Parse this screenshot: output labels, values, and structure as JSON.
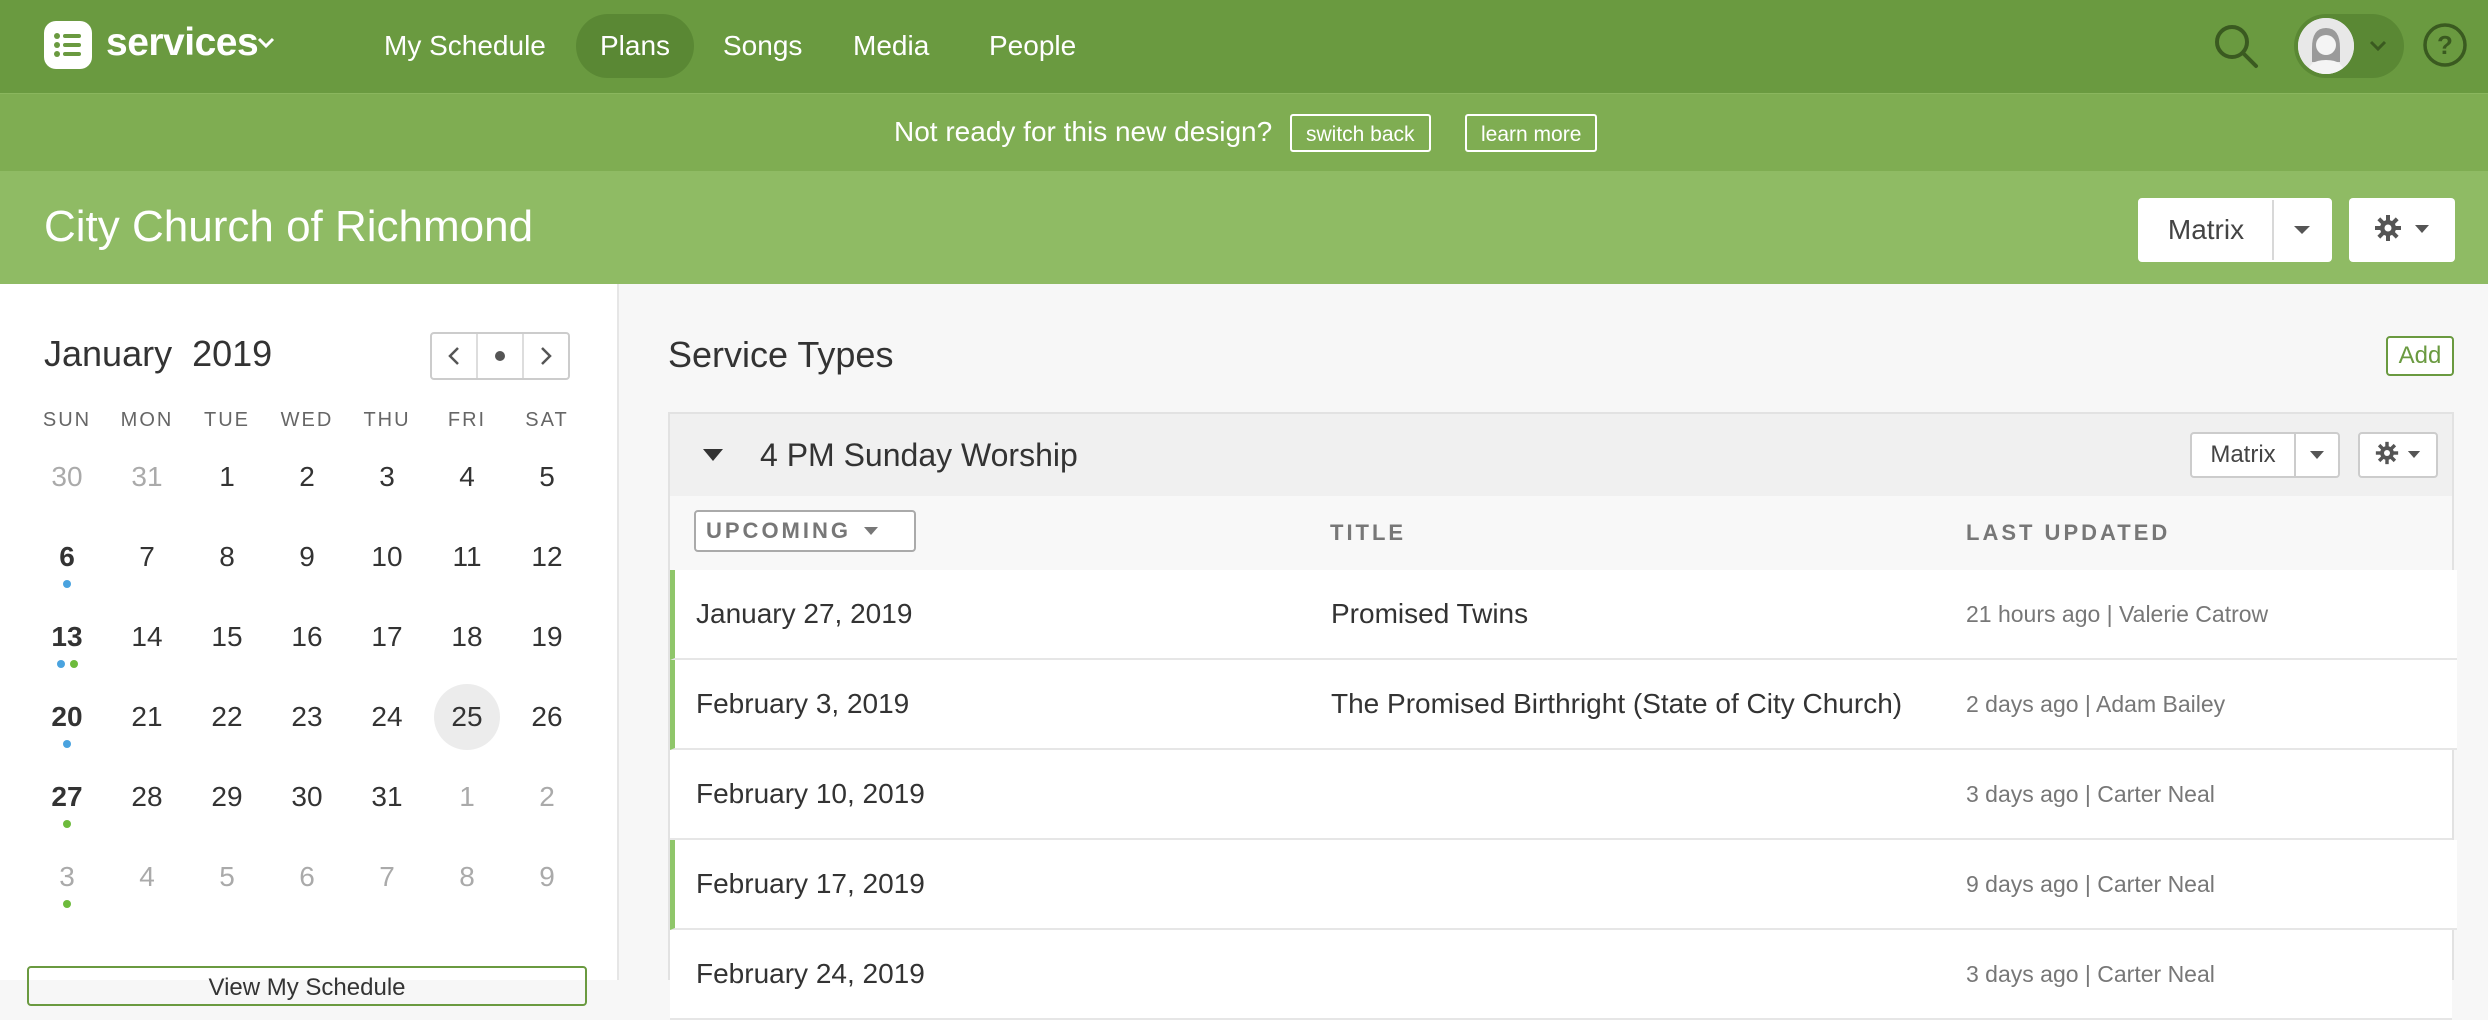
{
  "app": {
    "name": "services"
  },
  "nav": {
    "items": [
      {
        "label": "My Schedule",
        "active": false
      },
      {
        "label": "Plans",
        "active": true
      },
      {
        "label": "Songs",
        "active": false
      },
      {
        "label": "Media",
        "active": false
      },
      {
        "label": "People",
        "active": false
      }
    ]
  },
  "banner": {
    "text": "Not ready for this new design?",
    "switch_back": "switch back",
    "learn_more": "learn more"
  },
  "org": {
    "title": "City Church of Richmond",
    "view_label": "Matrix"
  },
  "calendar": {
    "month": "January",
    "year": "2019",
    "weekdays": [
      "SUN",
      "MON",
      "TUE",
      "WED",
      "THU",
      "FRI",
      "SAT"
    ],
    "weeks": [
      [
        {
          "d": "30",
          "other": true
        },
        {
          "d": "31",
          "other": true
        },
        {
          "d": "1"
        },
        {
          "d": "2"
        },
        {
          "d": "3"
        },
        {
          "d": "4"
        },
        {
          "d": "5"
        }
      ],
      [
        {
          "d": "6",
          "bold": true,
          "dots": [
            "blue"
          ]
        },
        {
          "d": "7"
        },
        {
          "d": "8"
        },
        {
          "d": "9"
        },
        {
          "d": "10"
        },
        {
          "d": "11"
        },
        {
          "d": "12"
        }
      ],
      [
        {
          "d": "13",
          "bold": true,
          "dots": [
            "blue",
            "green"
          ]
        },
        {
          "d": "14"
        },
        {
          "d": "15"
        },
        {
          "d": "16"
        },
        {
          "d": "17"
        },
        {
          "d": "18"
        },
        {
          "d": "19"
        }
      ],
      [
        {
          "d": "20",
          "bold": true,
          "dots": [
            "blue"
          ]
        },
        {
          "d": "21"
        },
        {
          "d": "22"
        },
        {
          "d": "23"
        },
        {
          "d": "24"
        },
        {
          "d": "25",
          "today": true
        },
        {
          "d": "26"
        }
      ],
      [
        {
          "d": "27",
          "bold": true,
          "dots": [
            "green"
          ]
        },
        {
          "d": "28"
        },
        {
          "d": "29"
        },
        {
          "d": "30"
        },
        {
          "d": "31"
        },
        {
          "d": "1",
          "other": true
        },
        {
          "d": "2",
          "other": true
        }
      ],
      [
        {
          "d": "3",
          "other": true,
          "dots": [
            "green"
          ]
        },
        {
          "d": "4",
          "other": true
        },
        {
          "d": "5",
          "other": true
        },
        {
          "d": "6",
          "other": true
        },
        {
          "d": "7",
          "other": true
        },
        {
          "d": "8",
          "other": true
        },
        {
          "d": "9",
          "other": true
        }
      ]
    ],
    "view_schedule": "View My Schedule"
  },
  "main": {
    "title": "Service Types",
    "add_label": "Add",
    "service_type": {
      "name": "4 PM Sunday Worship",
      "view_label": "Matrix",
      "filter_label": "UPCOMING",
      "columns": {
        "title": "TITLE",
        "last_updated": "LAST UPDATED"
      },
      "plans": [
        {
          "date": "January 27, 2019",
          "title": "Promised Twins",
          "updated": "21 hours ago | Valerie Catrow",
          "highlight": true
        },
        {
          "date": "February 3, 2019",
          "title": "The Promised Birthright (State of City Church)",
          "updated": "2 days ago | Adam Bailey",
          "highlight": true
        },
        {
          "date": "February 10, 2019",
          "title": "",
          "updated": "3 days ago | Carter Neal",
          "highlight": false
        },
        {
          "date": "February 17, 2019",
          "title": "",
          "updated": "9 days ago | Carter Neal",
          "highlight": true
        },
        {
          "date": "February 24, 2019",
          "title": "",
          "updated": "3 days ago | Carter Neal",
          "highlight": false
        }
      ]
    }
  },
  "colors": {
    "nav": "#6a9a40",
    "banner": "#7fad52",
    "org_bar": "#8fbb64",
    "accent": "#6a9a40",
    "dot_blue": "#4aa3df",
    "dot_green": "#6dbb3c"
  }
}
